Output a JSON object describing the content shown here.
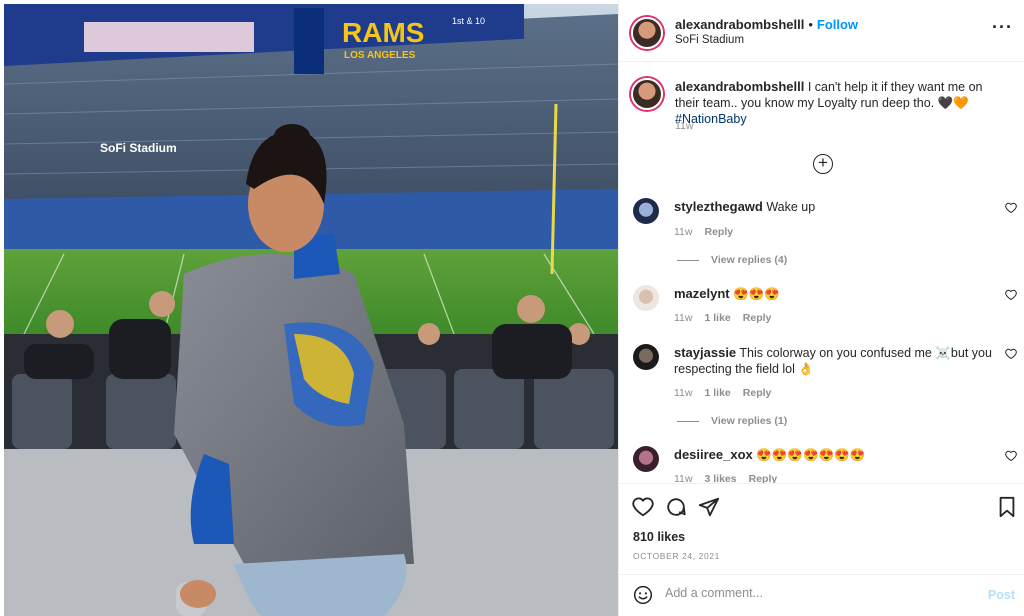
{
  "post": {
    "username": "alexandrabombshelll",
    "follow_label": "Follow",
    "separator": "•",
    "location": "SoFi Stadium",
    "more_icon": "more-horizontal-icon",
    "caption_text": "I can't help it if they want me on their team.. you know my Loyalty run deep tho. 🖤🧡",
    "caption_hashtag": "#NationBaby",
    "caption_time": "11w",
    "load_more_icon": "plus-circle-icon",
    "load_more_symbol": "+"
  },
  "scoreboard": {
    "rams_text": "RAMS",
    "la_text": "LOS ANGELES",
    "stadium_sign": "SoFi Stadium",
    "ticker": "1st & 10"
  },
  "comments": [
    {
      "username": "stylezthegawd",
      "text": "Wake up",
      "time": "11w",
      "likes": "",
      "reply": "Reply",
      "view_replies": "View replies (4)"
    },
    {
      "username": "mazelynt",
      "text": "😍😍😍",
      "time": "11w",
      "likes": "1 like",
      "reply": "Reply",
      "view_replies": ""
    },
    {
      "username": "stayjassie",
      "text": "This colorway on you confused me ☠️but you respecting the field lol 👌",
      "time": "11w",
      "likes": "1 like",
      "reply": "Reply",
      "view_replies": "View replies (1)"
    },
    {
      "username": "desiiree_xox",
      "text": "😍😍😍😍😍😍😍",
      "time": "11w",
      "likes": "3 likes",
      "reply": "Reply",
      "view_replies": ""
    }
  ],
  "actions": {
    "like_icon": "heart-icon",
    "comment_icon": "comment-icon",
    "share_icon": "send-icon",
    "save_icon": "bookmark-icon",
    "likes_count": "810 likes",
    "date": "OCTOBER 24, 2021"
  },
  "add_comment": {
    "placeholder": "Add a comment...",
    "post_label": "Post",
    "emoji_icon": "emoji-icon"
  },
  "colors": {
    "link_blue": "#0095f6",
    "hashtag_blue": "#00376b",
    "muted": "#8e8e8e",
    "post_disabled": "#b2dffc"
  }
}
